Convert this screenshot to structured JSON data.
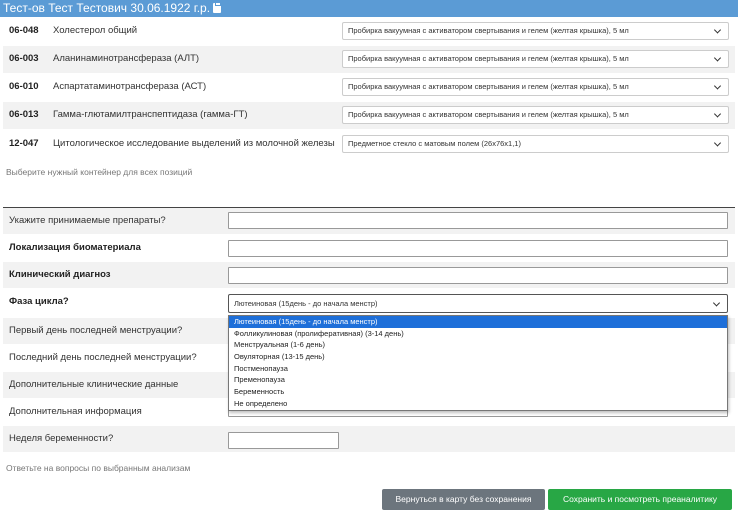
{
  "header": {
    "title": "Тест-ов Тест Тестович 30.06.1922 г.р."
  },
  "tests": [
    {
      "code": "06-048",
      "name": "Холестерол общий",
      "container": "Пробирка вакуумная с активатором свертывания и гелем (желтая крышка), 5 мл"
    },
    {
      "code": "06-003",
      "name": "Аланинаминотрансфераза (АЛТ)",
      "container": "Пробирка вакуумная с активатором свертывания и гелем (желтая крышка), 5 мл"
    },
    {
      "code": "06-010",
      "name": "Аспартатаминотрансфераза (АСТ)",
      "container": "Пробирка вакуумная с активатором свертывания и гелем (желтая крышка), 5 мл"
    },
    {
      "code": "06-013",
      "name": "Гамма-глютамилтранспептидаза (гамма-ГТ)",
      "container": "Пробирка вакуумная с активатором свертывания и гелем (желтая крышка), 5 мл"
    },
    {
      "code": "12-047",
      "name": "Цитологическое исследование выделений из молочной железы",
      "container": "Предметное стекло с матовым полем (26х76х1,1)"
    }
  ],
  "container_hint": "Выберите нужный контейнер для всех позиций",
  "questions": [
    {
      "label": "Укажите принимаемые препараты?",
      "value": ""
    },
    {
      "label": "Локализация биоматериала",
      "value": ""
    },
    {
      "label": "Клинический диагноз",
      "value": ""
    },
    {
      "label": "Фаза цикла?",
      "value": "Лютеиновая (15день - до начала менстр)"
    },
    {
      "label": "Первый день последней менструации?",
      "value": ""
    },
    {
      "label": "Последний день последней менструации?",
      "value": ""
    },
    {
      "label": "Дополнительные клинические данные",
      "value": ""
    },
    {
      "label": "Дополнительная информация",
      "value": ""
    },
    {
      "label": "Неделя беременности?",
      "value": ""
    }
  ],
  "cycle_phase_options": [
    "Лютеиновая (15день - до начала менстр)",
    "Фолликулиновая (пролиферативная) (3-14 день)",
    "Менструальная (1-6 день)",
    "Овуляторная (13-15 день)",
    "Постменопауза",
    "Пременопауза",
    "Беременность",
    "Не определено"
  ],
  "questions_hint": "Ответьте на вопросы по выбранным анализам",
  "buttons": {
    "back": "Вернуться в карту без сохранения",
    "save": "Сохранить и посмотреть преаналитику"
  },
  "colors": {
    "header": "#5b9bd5",
    "btn_back": "#6c757d",
    "btn_save": "#28a745",
    "selected_option": "#1e6fd9"
  }
}
